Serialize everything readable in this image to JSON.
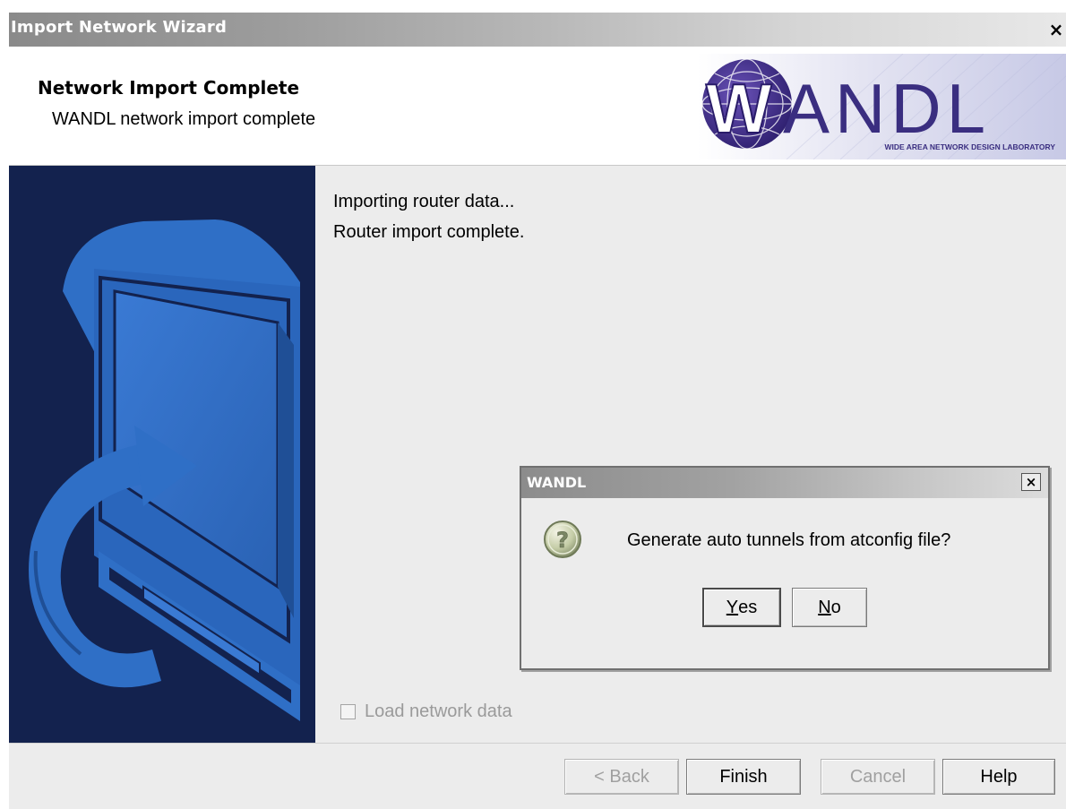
{
  "window": {
    "title": "Import Network Wizard",
    "close_glyph": "×"
  },
  "header": {
    "title": "Network Import Complete",
    "subtitle": "WANDL network import complete",
    "logo_text": "WANDL",
    "logo_tagline": "WIDE AREA NETWORK DESIGN LABORATORY"
  },
  "content": {
    "lines": [
      "Importing router data...",
      "Router import complete."
    ],
    "checkbox_label": "Load network data",
    "checkbox_checked": false,
    "checkbox_enabled": false
  },
  "buttons": {
    "back": "< Back",
    "finish": "Finish",
    "cancel": "Cancel",
    "help": "Help"
  },
  "dialog": {
    "title": "WANDL",
    "close_glyph": "×",
    "icon": "question-icon",
    "message": "Generate auto tunnels from atconfig file?",
    "yes_mnemonic": "Y",
    "yes_rest": "es",
    "no_mnemonic": "N",
    "no_rest": "o"
  },
  "colors": {
    "side_panel": "#13224e",
    "graphic_blue": "#2f6fc6",
    "logo_purple": "#3a2e80"
  }
}
